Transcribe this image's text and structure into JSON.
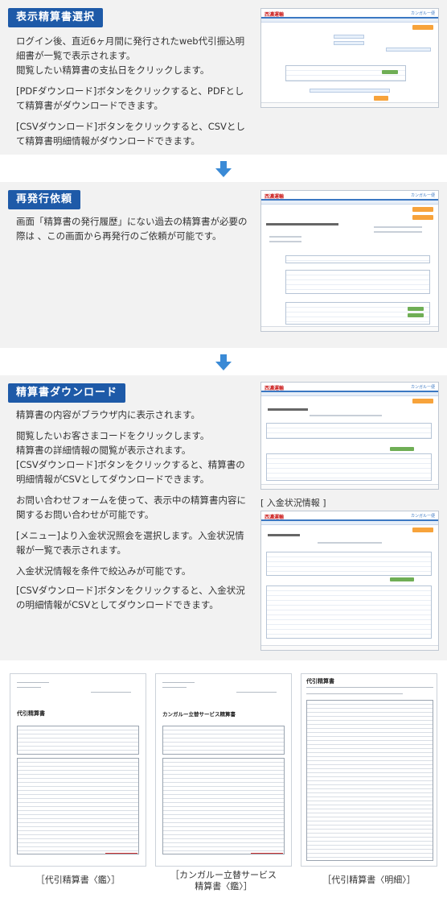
{
  "sections": [
    {
      "title": "表示精算書選択",
      "paragraphs": [
        "ログイン後、直近6ヶ月間に発行されたweb代引振込明細書が一覧で表示されます。\n閲覧したい精算書の支払日をクリックします。",
        "[PDFダウンロード]ボタンをクリックすると、PDFとして精算書がダウンロードできます。",
        "[CSVダウンロード]ボタンをクリックすると、CSVとして精算書明細情報がダウンロードできます。"
      ]
    },
    {
      "title": "再発行依頼",
      "paragraphs": [
        "画面「精算書の発行履歴」にない過去の精算書が必要の際は 、この画面から再発行のご依頼が可能です。"
      ]
    },
    {
      "title": "精算書ダウンロード",
      "paragraphs": [
        "精算書の内容がブラウザ内に表示されます。",
        "閲覧したいお客さまコードをクリックします。\n精算書の詳細情報の閲覧が表示されます。\n[CSVダウンロード]ボタンをクリックすると、精算書の明細情報がCSVとしてダウンロードできます。",
        "お問い合わせフォームを使って、表示中の精算書内容に関するお問い合わせが可能です。",
        "[メニュー]より入金状況照会を選択します。入金状況情報が一覧で表示されます。",
        "入金状況情報を条件で絞込みが可能です。",
        "[CSVダウンロード]ボタンをクリックすると、入金状況の明細情報がCSVとしてダウンロードできます。"
      ],
      "screenshot_caption": "[ 入金状況情報 ]"
    }
  ],
  "screens": {
    "logo": "西濃運輸",
    "brand": "カンガルー便",
    "doc_title": "代引精算書",
    "doc_title_2": "カンガルー立替サービス精算書",
    "doc_title_3": "代引精算書"
  },
  "documents": [
    {
      "caption": "［代引精算書〈鑑〉］"
    },
    {
      "caption": "［カンガルー立替サービス\n精算書〈鑑〉］"
    },
    {
      "caption": "［代引精算書〈明細〉］"
    }
  ],
  "colors": {
    "title_bg": "#1e5aa8",
    "arrow": "#3a8ad6",
    "section_bg": "#f2f2f2"
  }
}
